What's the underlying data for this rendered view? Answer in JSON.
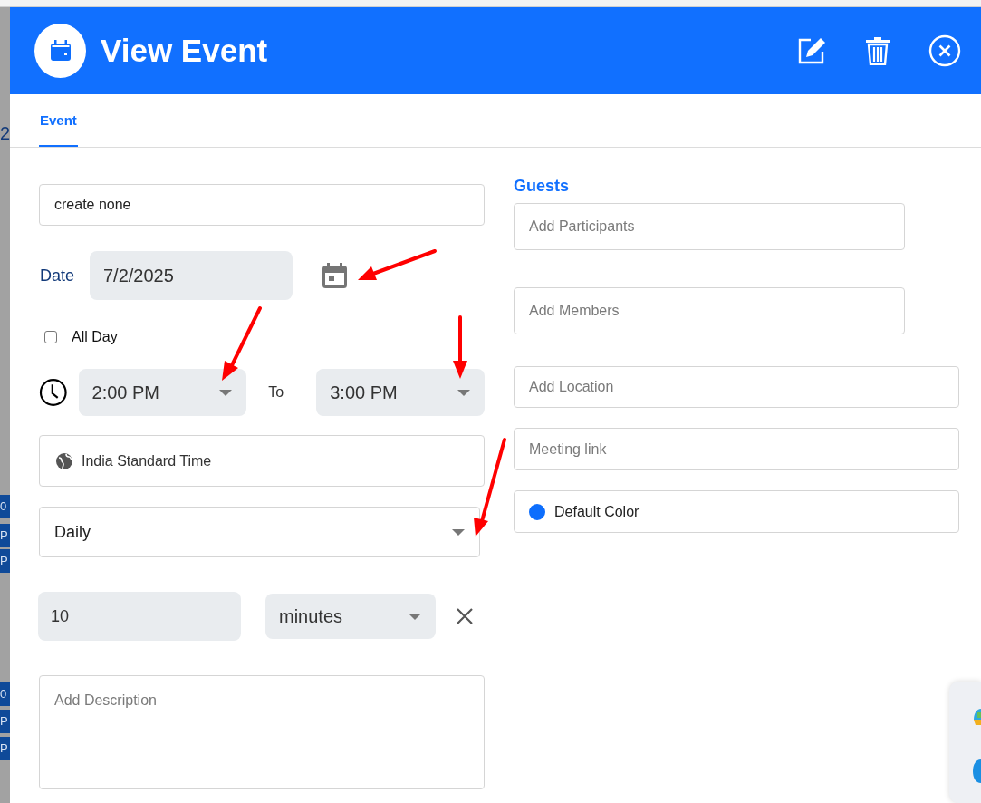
{
  "backdrop": {
    "date_fragment": "2",
    "event_chips": [
      {
        "text": "0"
      },
      {
        "text": "P"
      },
      {
        "text": "P"
      },
      {
        "text": "0"
      },
      {
        "text": "P"
      },
      {
        "text": "P"
      }
    ]
  },
  "dialog": {
    "title": "View Event",
    "tabs": [
      {
        "label": "Event",
        "selected": true
      }
    ]
  },
  "form": {
    "title_value": "create none",
    "date_label": "Date",
    "date_value": "7/2/2025",
    "all_day": {
      "label": "All Day",
      "checked": false
    },
    "start_time": "2:00 PM",
    "to_label": "To",
    "end_time": "3:00 PM",
    "timezone": "India Standard Time",
    "recurrence": "Daily",
    "reminder": {
      "value": "10",
      "unit": "minutes"
    },
    "description": {
      "placeholder": "Add Description"
    }
  },
  "guests": {
    "heading": "Guests",
    "participants_placeholder": "Add Participants",
    "members_placeholder": "Add Members"
  },
  "location": {
    "placeholder": "Add Location"
  },
  "meeting_link": {
    "placeholder": "Meeting link"
  },
  "event_color": {
    "label": "Default Color",
    "color": "#0d6efd"
  }
}
